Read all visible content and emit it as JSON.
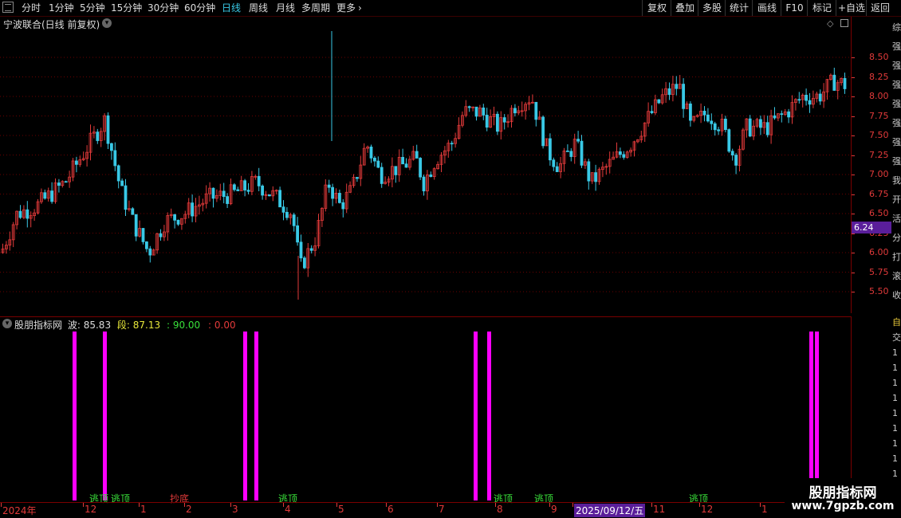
{
  "toolbar": {
    "periods": [
      "分时",
      "1分钟",
      "5分钟",
      "15分钟",
      "30分钟",
      "60分钟",
      "日线",
      "周线",
      "月线",
      "多周期",
      "更多"
    ],
    "active_period": "日线",
    "more_arrow": "›",
    "right_buttons": [
      "复权",
      "叠加",
      "多股",
      "统计",
      "画线",
      "F10",
      "标记",
      "+自选",
      "返回"
    ]
  },
  "main_chart": {
    "title": "宁波联合(日线 前复权)",
    "current_price_tag": "6.24",
    "price_ticks": [
      "8.50",
      "8.25",
      "8.00",
      "7.75",
      "7.50",
      "7.25",
      "7.00",
      "6.75",
      "6.50",
      "6.25",
      "6.00",
      "5.75",
      "5.50"
    ]
  },
  "indicator": {
    "name": "股朋指标网",
    "wave_label": "波:",
    "wave_value": "85.83",
    "seg_label": "段:",
    "seg_value": "87.13",
    "line3": ": 90.00",
    "line4": ": 0.00",
    "signals": [
      {
        "text": "逃顶",
        "pos": 0.105,
        "color": "#39e03a"
      },
      {
        "text": "逃顶",
        "pos": 0.13,
        "color": "#39e03a"
      },
      {
        "text": "抄底",
        "pos": 0.2,
        "color": "#e23a3a"
      },
      {
        "text": "逃顶",
        "pos": 0.327,
        "color": "#39e03a"
      },
      {
        "text": "逃顶",
        "pos": 0.58,
        "color": "#39e03a"
      },
      {
        "text": "逃顶",
        "pos": 0.628,
        "color": "#39e03a"
      },
      {
        "text": "逃顶",
        "pos": 0.81,
        "color": "#39e03a"
      }
    ],
    "spike_positions": [
      0.085,
      0.121,
      0.286,
      0.299,
      0.557,
      0.573,
      0.951,
      0.958
    ]
  },
  "date_axis": {
    "labels": [
      "2024年",
      "12",
      "1",
      "2",
      "3",
      "4",
      "5",
      "6",
      "7",
      "8",
      "9",
      "2025/09/12/五",
      "11",
      "12",
      "1"
    ],
    "highlight": "2025/09/12/五"
  },
  "side_strip": {
    "chars": [
      "综",
      "强",
      "强",
      "强",
      "强",
      "强",
      "强",
      "强",
      "我",
      "开",
      "活",
      "分",
      "打",
      "滚",
      "收"
    ],
    "lower_chars": [
      "自",
      "交",
      "1",
      "1",
      "1",
      "1",
      "1",
      "1",
      "1",
      "1",
      "1",
      "1"
    ]
  },
  "watermark": {
    "title": "股朋指标网",
    "url": "www.7gpzb.com"
  },
  "colors": {
    "up": "#e23a3a",
    "down": "#39c9e6",
    "spike": "#ff00ff",
    "grid": "#6a0000",
    "price_tag_bg": "#5a1e9a"
  }
}
